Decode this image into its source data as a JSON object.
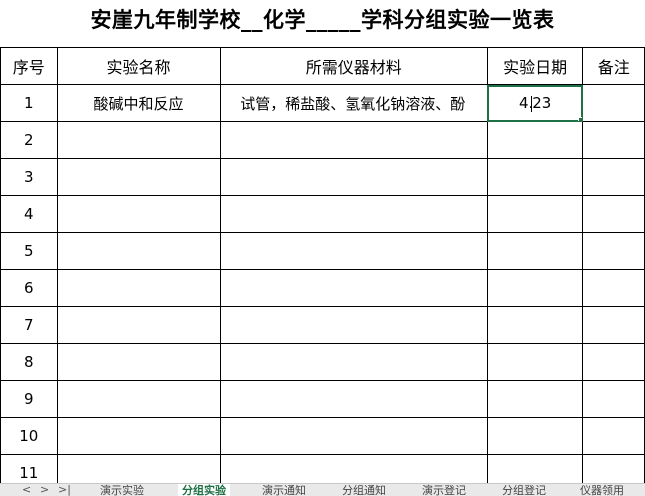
{
  "sheet": {
    "title": "安崖九年制学校__化学_____学科分组实验一览表",
    "headers": {
      "index": "序号",
      "experiment_name": "实验名称",
      "materials": "所需仪器材料",
      "date": "实验日期",
      "notes": "备注"
    },
    "rows": [
      {
        "index": "1",
        "experiment_name": "酸碱中和反应",
        "materials": "试管，稀盐酸、氢氧化钠溶液、酚",
        "date": "4.23",
        "notes": ""
      },
      {
        "index": "2",
        "experiment_name": "",
        "materials": "",
        "date": "",
        "notes": ""
      },
      {
        "index": "3",
        "experiment_name": "",
        "materials": "",
        "date": "",
        "notes": ""
      },
      {
        "index": "4",
        "experiment_name": "",
        "materials": "",
        "date": "",
        "notes": ""
      },
      {
        "index": "5",
        "experiment_name": "",
        "materials": "",
        "date": "",
        "notes": ""
      },
      {
        "index": "6",
        "experiment_name": "",
        "materials": "",
        "date": "",
        "notes": ""
      },
      {
        "index": "7",
        "experiment_name": "",
        "materials": "",
        "date": "",
        "notes": ""
      },
      {
        "index": "8",
        "experiment_name": "",
        "materials": "",
        "date": "",
        "notes": ""
      },
      {
        "index": "9",
        "experiment_name": "",
        "materials": "",
        "date": "",
        "notes": ""
      },
      {
        "index": "10",
        "experiment_name": "",
        "materials": "",
        "date": "",
        "notes": ""
      },
      {
        "index": "11",
        "experiment_name": "",
        "materials": "",
        "date": "",
        "notes": ""
      }
    ],
    "active_cell": "D1"
  },
  "tabbar": {
    "nav_prev": "<",
    "nav_next": ">",
    "nav_last": ">|",
    "tabs": [
      {
        "label": "演示实验",
        "active": false
      },
      {
        "label": "分组实验",
        "active": true
      },
      {
        "label": "演示通知",
        "active": false
      },
      {
        "label": "分组通知",
        "active": false
      },
      {
        "label": "演示登记",
        "active": false
      },
      {
        "label": "分组登记",
        "active": false
      },
      {
        "label": "仪器领用",
        "active": false
      }
    ]
  },
  "colors": {
    "active_cell_border": "#1e7145",
    "grid_line": "#000000",
    "tabbar_bg": "#e9e9e9"
  }
}
